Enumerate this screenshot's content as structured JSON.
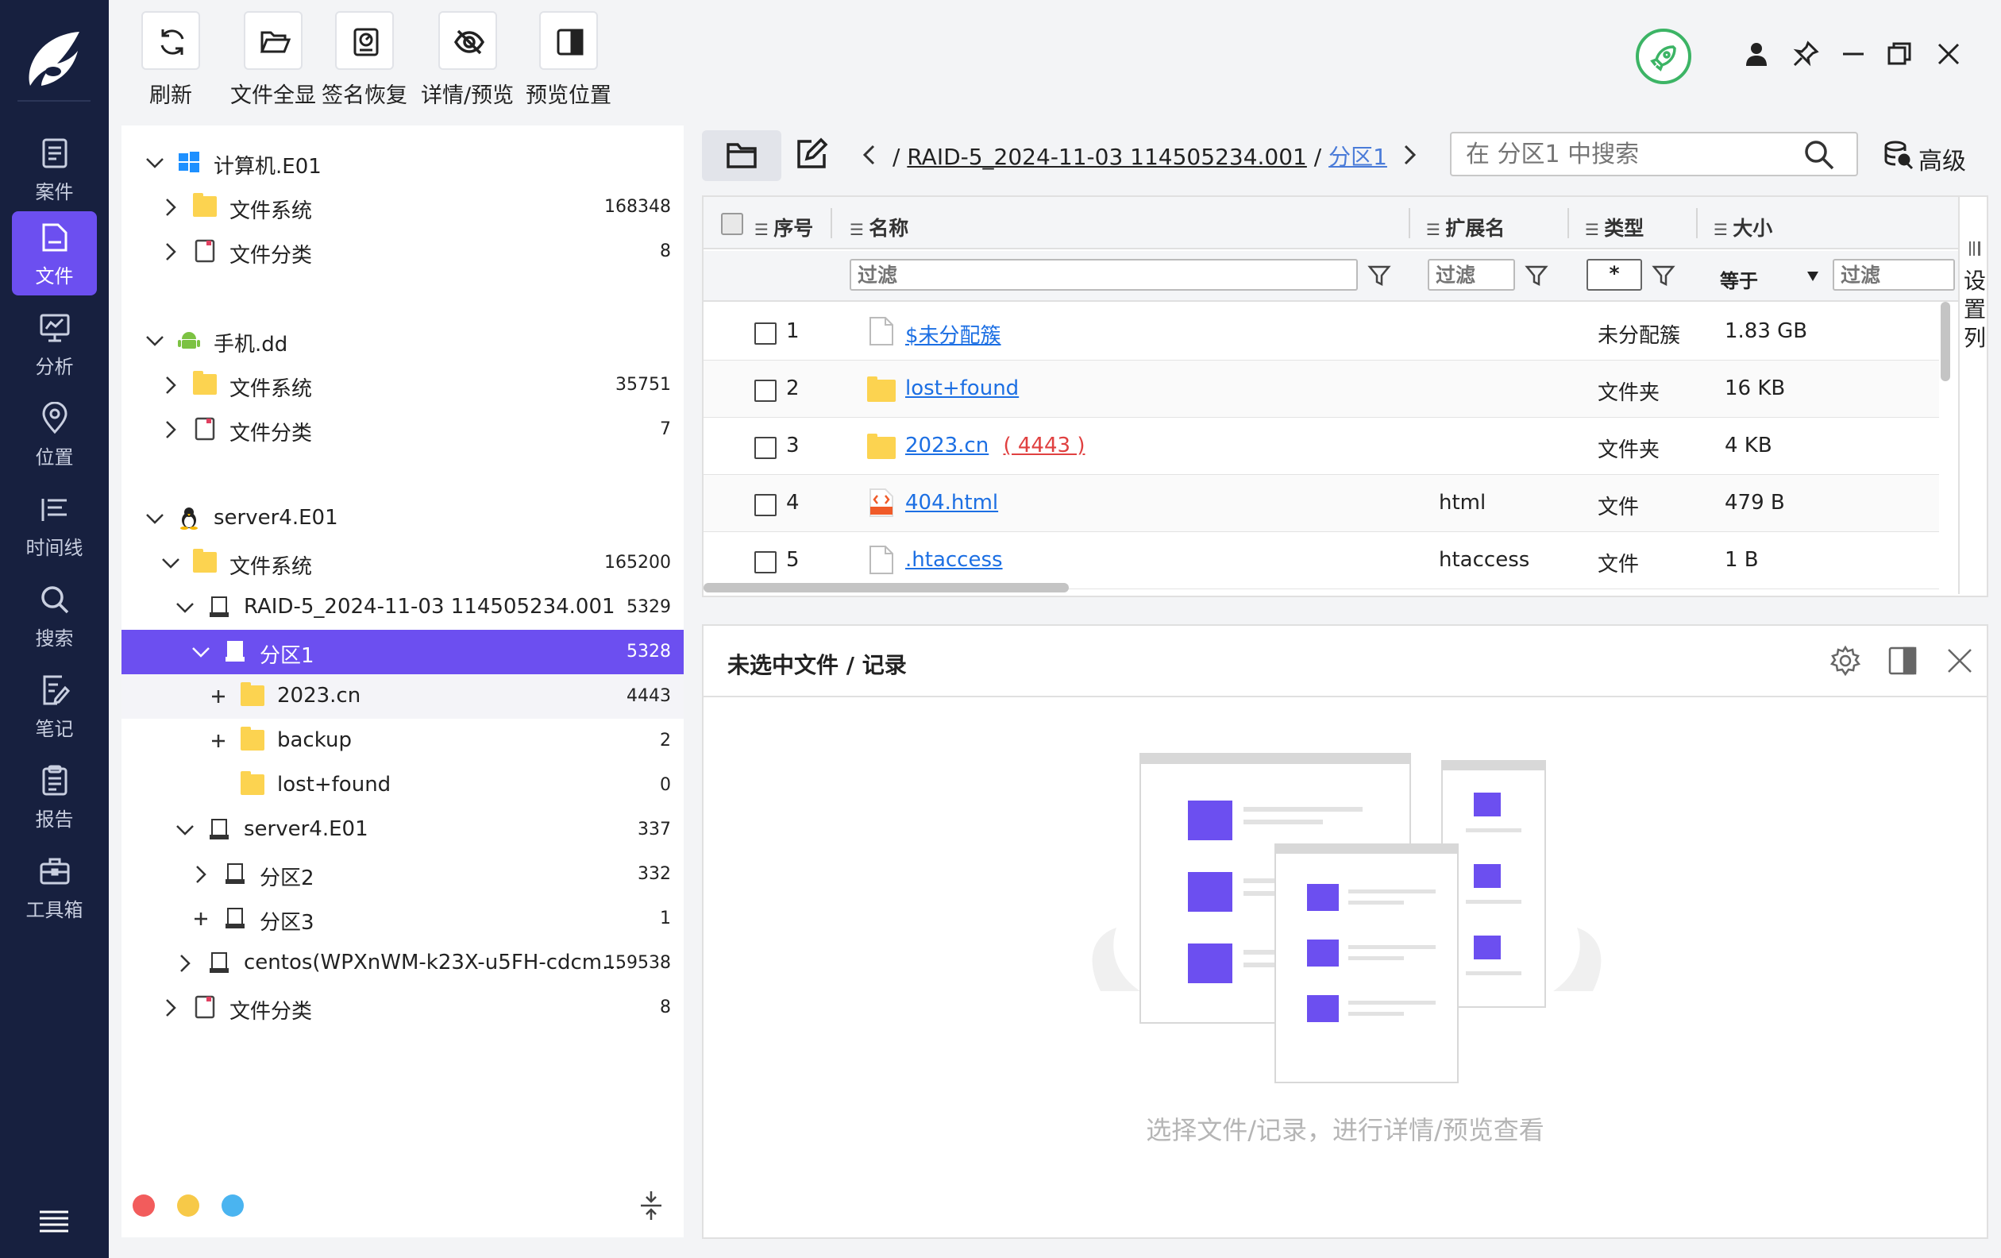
{
  "rail": {
    "items": [
      {
        "label": "案件",
        "icon": "case-icon"
      },
      {
        "label": "文件",
        "icon": "file-icon"
      },
      {
        "label": "分析",
        "icon": "analysis-icon"
      },
      {
        "label": "位置",
        "icon": "location-icon"
      },
      {
        "label": "时间线",
        "icon": "timeline-icon"
      },
      {
        "label": "搜索",
        "icon": "search-icon"
      },
      {
        "label": "笔记",
        "icon": "note-icon"
      },
      {
        "label": "报告",
        "icon": "report-icon"
      },
      {
        "label": "工具箱",
        "icon": "toolbox-icon"
      }
    ],
    "active_index": 1
  },
  "toolbar": {
    "refresh": "刷新",
    "show_all": "文件全显",
    "sig_restore": "签名恢复",
    "detail_preview": "详情/预览",
    "preview_pos": "预览位置"
  },
  "tree": {
    "rows": [
      {
        "label": "计算机.E01",
        "count": "",
        "icon": "windows-icon"
      },
      {
        "label": "文件系统",
        "count": "168348",
        "icon": "folder-icon"
      },
      {
        "label": "文件分类",
        "count": "8",
        "icon": "category-icon"
      },
      {
        "label": "手机.dd",
        "count": "",
        "icon": "android-icon"
      },
      {
        "label": "文件系统",
        "count": "35751",
        "icon": "folder-icon"
      },
      {
        "label": "文件分类",
        "count": "7",
        "icon": "category-icon"
      },
      {
        "label": "server4.E01",
        "count": "",
        "icon": "linux-icon"
      },
      {
        "label": "文件系统",
        "count": "165200",
        "icon": "folder-icon"
      },
      {
        "label": "RAID-5_2024-11-03 114505234.001",
        "count": "5329",
        "icon": "disk-icon"
      },
      {
        "label": "分区1",
        "count": "5328",
        "icon": "disk-icon"
      },
      {
        "label": "2023.cn",
        "count": "4443",
        "icon": "folder-icon"
      },
      {
        "label": "backup",
        "count": "2",
        "icon": "folder-icon"
      },
      {
        "label": "lost+found",
        "count": "0",
        "icon": "folder-icon"
      },
      {
        "label": "server4.E01",
        "count": "337",
        "icon": "disk-icon"
      },
      {
        "label": "分区2",
        "count": "332",
        "icon": "disk-icon"
      },
      {
        "label": "分区3",
        "count": "1",
        "icon": "disk-icon"
      },
      {
        "label": "centos(WPXnWM-k23X-u5FH-cdcm...",
        "count": "159538",
        "icon": "disk-icon"
      },
      {
        "label": "文件分类",
        "count": "8",
        "icon": "category-icon"
      }
    ]
  },
  "path": {
    "separator": "/",
    "raid": "RAID-5_2024-11-03 114505234.001",
    "current": "分区1"
  },
  "search": {
    "placeholder": "在 分区1 中搜索"
  },
  "advanced": "高级",
  "grid": {
    "headers": {
      "seq": "序号",
      "name": "名称",
      "ext": "扩展名",
      "type": "类型",
      "size": "大小"
    },
    "filter": {
      "placeholder": "过滤",
      "ext_value": "*",
      "op": "等于"
    },
    "rows": [
      {
        "seq": "1",
        "name": "$未分配簇",
        "count": "",
        "ext": "",
        "type": "未分配簇",
        "size": "1.83 GB",
        "icon": "blank-file-icon"
      },
      {
        "seq": "2",
        "name": "lost+found",
        "count": "",
        "ext": "",
        "type": "文件夹",
        "size": "16 KB",
        "icon": "folder-icon"
      },
      {
        "seq": "3",
        "name": "2023.cn",
        "count": "( 4443 )",
        "ext": "",
        "type": "文件夹",
        "size": "4 KB",
        "icon": "folder-icon"
      },
      {
        "seq": "4",
        "name": "404.html",
        "count": "",
        "ext": "html",
        "type": "文件",
        "size": "479 B",
        "icon": "html-file-icon"
      },
      {
        "seq": "5",
        "name": ".htaccess",
        "count": "",
        "ext": "htaccess",
        "type": "文件",
        "size": "1 B",
        "icon": "blank-file-icon"
      }
    ],
    "col_settings": "设置列"
  },
  "detail": {
    "title": "未选中文件 / 记录",
    "empty_text": "选择文件/记录，进行详情/预览查看"
  },
  "colors": {
    "rail_bg": "#17203f",
    "accent": "#6c4ff0",
    "link": "#1c6fe3",
    "count_red": "#e04040",
    "shield_green": "#3cb465"
  }
}
